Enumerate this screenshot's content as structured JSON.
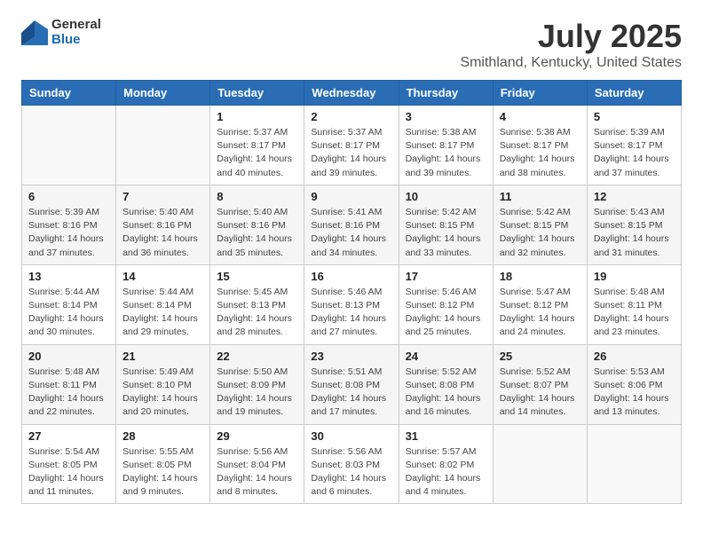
{
  "header": {
    "logo_general": "General",
    "logo_blue": "Blue",
    "main_title": "July 2025",
    "sub_title": "Smithland, Kentucky, United States"
  },
  "days_of_week": [
    "Sunday",
    "Monday",
    "Tuesday",
    "Wednesday",
    "Thursday",
    "Friday",
    "Saturday"
  ],
  "weeks": [
    [
      {
        "day": "",
        "info": ""
      },
      {
        "day": "",
        "info": ""
      },
      {
        "day": "1",
        "info": "Sunrise: 5:37 AM\nSunset: 8:17 PM\nDaylight: 14 hours\nand 40 minutes."
      },
      {
        "day": "2",
        "info": "Sunrise: 5:37 AM\nSunset: 8:17 PM\nDaylight: 14 hours\nand 39 minutes."
      },
      {
        "day": "3",
        "info": "Sunrise: 5:38 AM\nSunset: 8:17 PM\nDaylight: 14 hours\nand 39 minutes."
      },
      {
        "day": "4",
        "info": "Sunrise: 5:38 AM\nSunset: 8:17 PM\nDaylight: 14 hours\nand 38 minutes."
      },
      {
        "day": "5",
        "info": "Sunrise: 5:39 AM\nSunset: 8:17 PM\nDaylight: 14 hours\nand 37 minutes."
      }
    ],
    [
      {
        "day": "6",
        "info": "Sunrise: 5:39 AM\nSunset: 8:16 PM\nDaylight: 14 hours\nand 37 minutes."
      },
      {
        "day": "7",
        "info": "Sunrise: 5:40 AM\nSunset: 8:16 PM\nDaylight: 14 hours\nand 36 minutes."
      },
      {
        "day": "8",
        "info": "Sunrise: 5:40 AM\nSunset: 8:16 PM\nDaylight: 14 hours\nand 35 minutes."
      },
      {
        "day": "9",
        "info": "Sunrise: 5:41 AM\nSunset: 8:16 PM\nDaylight: 14 hours\nand 34 minutes."
      },
      {
        "day": "10",
        "info": "Sunrise: 5:42 AM\nSunset: 8:15 PM\nDaylight: 14 hours\nand 33 minutes."
      },
      {
        "day": "11",
        "info": "Sunrise: 5:42 AM\nSunset: 8:15 PM\nDaylight: 14 hours\nand 32 minutes."
      },
      {
        "day": "12",
        "info": "Sunrise: 5:43 AM\nSunset: 8:15 PM\nDaylight: 14 hours\nand 31 minutes."
      }
    ],
    [
      {
        "day": "13",
        "info": "Sunrise: 5:44 AM\nSunset: 8:14 PM\nDaylight: 14 hours\nand 30 minutes."
      },
      {
        "day": "14",
        "info": "Sunrise: 5:44 AM\nSunset: 8:14 PM\nDaylight: 14 hours\nand 29 minutes."
      },
      {
        "day": "15",
        "info": "Sunrise: 5:45 AM\nSunset: 8:13 PM\nDaylight: 14 hours\nand 28 minutes."
      },
      {
        "day": "16",
        "info": "Sunrise: 5:46 AM\nSunset: 8:13 PM\nDaylight: 14 hours\nand 27 minutes."
      },
      {
        "day": "17",
        "info": "Sunrise: 5:46 AM\nSunset: 8:12 PM\nDaylight: 14 hours\nand 25 minutes."
      },
      {
        "day": "18",
        "info": "Sunrise: 5:47 AM\nSunset: 8:12 PM\nDaylight: 14 hours\nand 24 minutes."
      },
      {
        "day": "19",
        "info": "Sunrise: 5:48 AM\nSunset: 8:11 PM\nDaylight: 14 hours\nand 23 minutes."
      }
    ],
    [
      {
        "day": "20",
        "info": "Sunrise: 5:48 AM\nSunset: 8:11 PM\nDaylight: 14 hours\nand 22 minutes."
      },
      {
        "day": "21",
        "info": "Sunrise: 5:49 AM\nSunset: 8:10 PM\nDaylight: 14 hours\nand 20 minutes."
      },
      {
        "day": "22",
        "info": "Sunrise: 5:50 AM\nSunset: 8:09 PM\nDaylight: 14 hours\nand 19 minutes."
      },
      {
        "day": "23",
        "info": "Sunrise: 5:51 AM\nSunset: 8:08 PM\nDaylight: 14 hours\nand 17 minutes."
      },
      {
        "day": "24",
        "info": "Sunrise: 5:52 AM\nSunset: 8:08 PM\nDaylight: 14 hours\nand 16 minutes."
      },
      {
        "day": "25",
        "info": "Sunrise: 5:52 AM\nSunset: 8:07 PM\nDaylight: 14 hours\nand 14 minutes."
      },
      {
        "day": "26",
        "info": "Sunrise: 5:53 AM\nSunset: 8:06 PM\nDaylight: 14 hours\nand 13 minutes."
      }
    ],
    [
      {
        "day": "27",
        "info": "Sunrise: 5:54 AM\nSunset: 8:05 PM\nDaylight: 14 hours\nand 11 minutes."
      },
      {
        "day": "28",
        "info": "Sunrise: 5:55 AM\nSunset: 8:05 PM\nDaylight: 14 hours\nand 9 minutes."
      },
      {
        "day": "29",
        "info": "Sunrise: 5:56 AM\nSunset: 8:04 PM\nDaylight: 14 hours\nand 8 minutes."
      },
      {
        "day": "30",
        "info": "Sunrise: 5:56 AM\nSunset: 8:03 PM\nDaylight: 14 hours\nand 6 minutes."
      },
      {
        "day": "31",
        "info": "Sunrise: 5:57 AM\nSunset: 8:02 PM\nDaylight: 14 hours\nand 4 minutes."
      },
      {
        "day": "",
        "info": ""
      },
      {
        "day": "",
        "info": ""
      }
    ]
  ]
}
